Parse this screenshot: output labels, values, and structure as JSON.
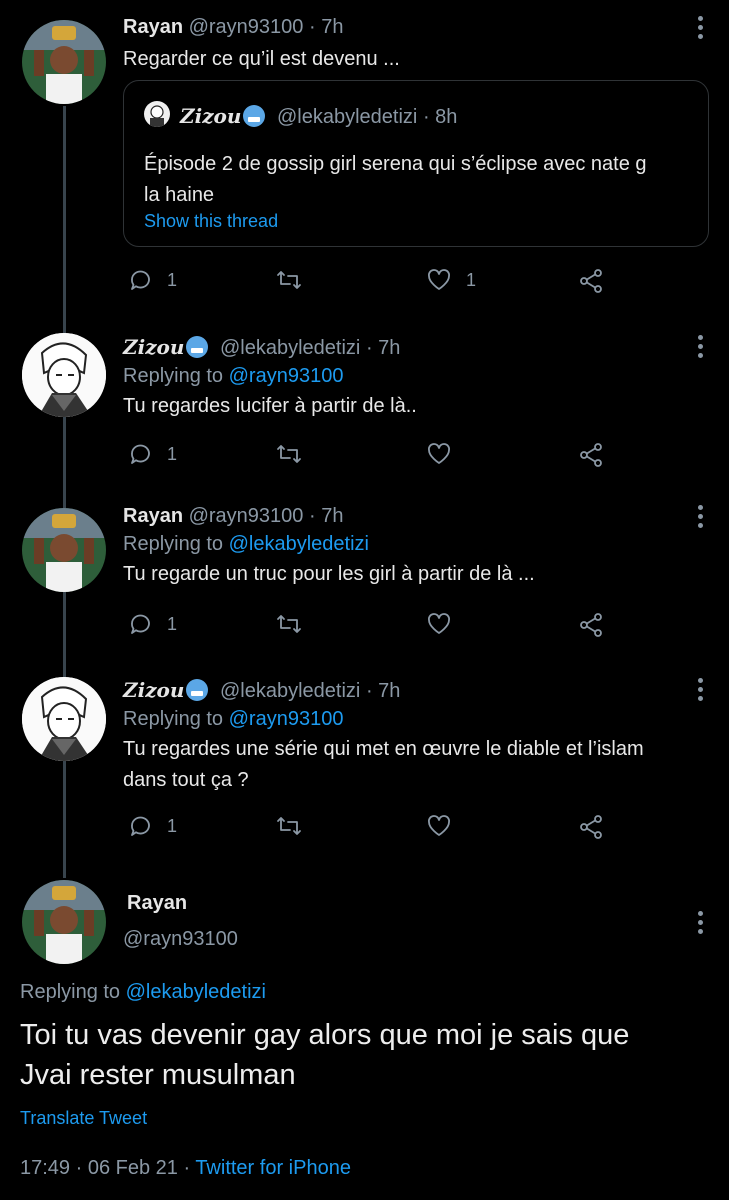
{
  "tweets": [
    {
      "name": "Rayan",
      "handle": "@rayn93100",
      "time": "7h",
      "text": "Regarder ce qu’il est devenu ...",
      "reply_count": "1",
      "like_count": "1"
    },
    {
      "name": "Zizou",
      "handle": "@lekabyledetizi",
      "time": "7h",
      "replying_prefix": "Replying to",
      "replying_to": "@rayn93100",
      "text": "Tu regardes lucifer à partir de là..",
      "reply_count": "1",
      "like_count": ""
    },
    {
      "name": "Rayan",
      "handle": "@rayn93100",
      "time": "7h",
      "replying_prefix": "Replying to",
      "replying_to": "@lekabyledetizi",
      "text": "Tu regarde un truc pour les girl à partir de là ...",
      "reply_count": "1",
      "like_count": ""
    },
    {
      "name": "Zizou",
      "handle": "@lekabyledetizi",
      "time": "7h",
      "replying_prefix": "Replying to",
      "replying_to": "@rayn93100",
      "text_line1": "Tu regardes une série qui met en œuvre le diable et l’islam",
      "text_line2": "dans tout ça ?",
      "reply_count": "1",
      "like_count": ""
    }
  ],
  "quote": {
    "name": "Zizou",
    "handle": "@lekabyledetizi",
    "time": "8h",
    "text_line1": "Épisode 2 de gossip girl serena qui s’éclipse avec nate g",
    "text_line2": "la haine",
    "show_thread": "Show this thread"
  },
  "main": {
    "name": "Rayan",
    "handle": "@rayn93100",
    "replying_prefix": "Replying to",
    "replying_to": "@lekabyledetizi",
    "text_line1": "Toi tu vas devenir gay alors que moi je sais que",
    "text_line2": "Jvai rester musulman",
    "translate": "Translate Tweet",
    "timestamp": "17:49 · 06 Feb 21 ·",
    "source": "Twitter for iPhone"
  },
  "colors": {
    "background": "#000000",
    "link": "#1d9bf0",
    "muted": "#8b98a5",
    "thread_line": "#38444d",
    "quote_border": "#2f3336"
  }
}
